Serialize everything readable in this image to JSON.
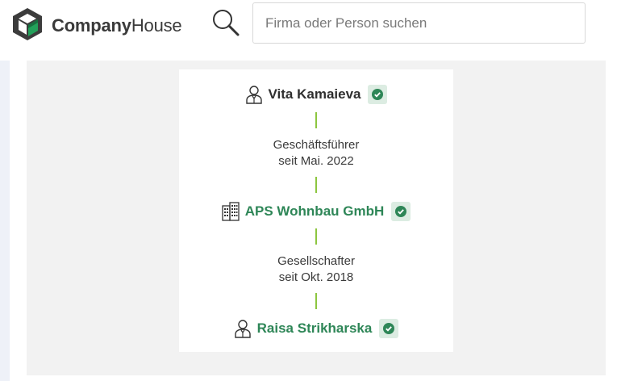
{
  "brand": {
    "name_bold": "Company",
    "name_rest": "House",
    "logo_colors": {
      "dark": "#3c3c3c",
      "green": "#23a05a",
      "dark_green": "#186f3f"
    }
  },
  "search": {
    "placeholder": "Firma oder Person suchen",
    "value": "",
    "icon": "search-icon"
  },
  "graph": {
    "colors": {
      "link": "#2e8657",
      "connector": "#8cc63f",
      "verified_bg": "#dcece2",
      "verified_fg": "#2e8657"
    },
    "nodes": [
      {
        "name": "Vita Kamaieva",
        "type": "person",
        "icon": "person-icon",
        "verified": true,
        "link": false
      },
      {
        "name": "APS Wohnbau GmbH",
        "type": "company",
        "icon": "building-icon",
        "verified": true,
        "link": true
      },
      {
        "name": "Raisa Strikharska",
        "type": "person",
        "icon": "person-icon",
        "verified": true,
        "link": true
      }
    ],
    "relations": [
      {
        "role": "Geschäftsführer",
        "since": "seit Mai. 2022"
      },
      {
        "role": "Gesellschafter",
        "since": "seit Okt. 2018"
      }
    ]
  }
}
